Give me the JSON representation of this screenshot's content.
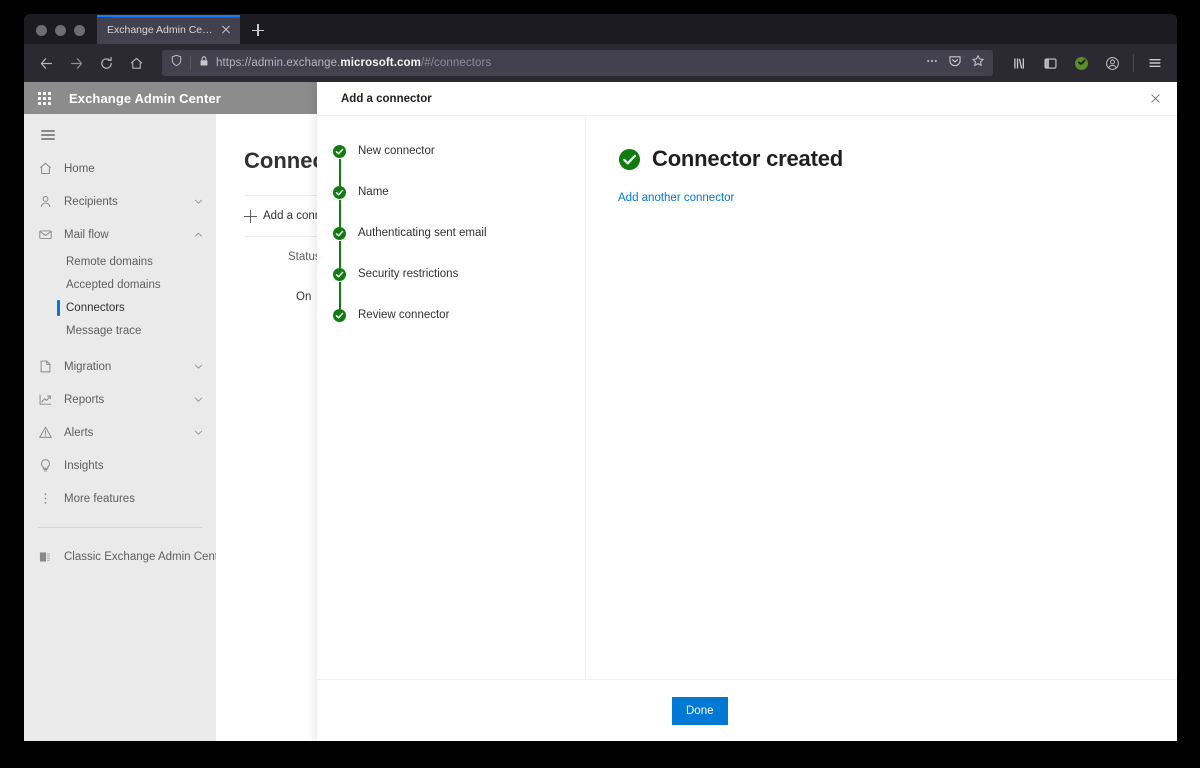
{
  "browser": {
    "tab_title": "Exchange Admin Center",
    "url_display_prefix": "https://admin.exchange.",
    "url_display_domain": "microsoft.com",
    "url_display_path": "/#/connectors",
    "accent_color": "#0a84ff"
  },
  "app": {
    "title": "Exchange Admin Center",
    "header_bg": "#8c8c8c"
  },
  "sidebar": {
    "items": [
      {
        "label": "Home",
        "icon": "home-icon",
        "expandable": false
      },
      {
        "label": "Recipients",
        "icon": "person-icon",
        "expandable": true
      },
      {
        "label": "Mail flow",
        "icon": "mail-icon",
        "expandable": true,
        "expanded": true
      },
      {
        "label": "Migration",
        "icon": "migration-icon",
        "expandable": true
      },
      {
        "label": "Reports",
        "icon": "reports-icon",
        "expandable": true
      },
      {
        "label": "Alerts",
        "icon": "alert-icon",
        "expandable": true
      },
      {
        "label": "Insights",
        "icon": "lightbulb-icon",
        "expandable": false
      },
      {
        "label": "More features",
        "icon": "more-icon",
        "expandable": false
      }
    ],
    "mail_flow_children": [
      {
        "label": "Remote domains",
        "selected": false
      },
      {
        "label": "Accepted domains",
        "selected": false
      },
      {
        "label": "Connectors",
        "selected": true
      },
      {
        "label": "Message trace",
        "selected": false
      }
    ],
    "footer_item": {
      "label": "Classic Exchange Admin Center",
      "icon": "classic-eac-icon"
    },
    "selected_color": "#0078d4"
  },
  "main": {
    "page_title": "Connectors",
    "add_command": "Add a connector",
    "table_header_status": "Status",
    "table_row_status": "On"
  },
  "modal": {
    "title": "Add a connector",
    "close_label": "Close",
    "steps": [
      {
        "label": "New connector",
        "state": "complete"
      },
      {
        "label": "Name",
        "state": "complete"
      },
      {
        "label": "Authenticating sent email",
        "state": "complete"
      },
      {
        "label": "Security restrictions",
        "state": "complete"
      },
      {
        "label": "Review connector",
        "state": "complete"
      }
    ],
    "result": {
      "title": "Connector created",
      "icon": "success-check-icon",
      "link": "Add another connector"
    },
    "footer": {
      "done_label": "Done",
      "primary_color": "#0078d4"
    },
    "success_color": "#107c10"
  }
}
